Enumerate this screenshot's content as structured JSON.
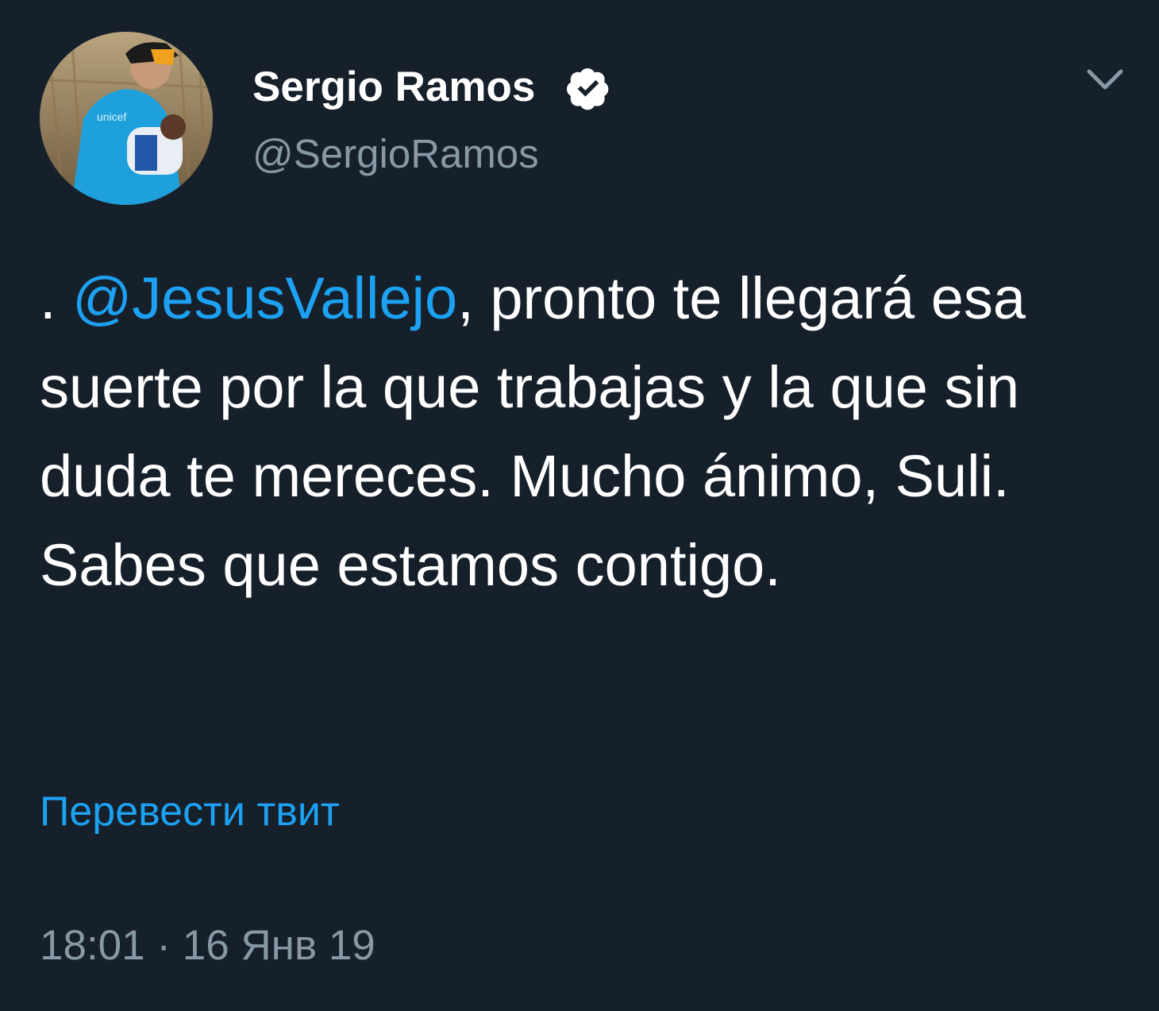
{
  "author": {
    "display_name": "Sergio Ramos",
    "verified": true,
    "handle": "@SergioRamos",
    "avatar_icon": "profile-photo"
  },
  "tweet": {
    "prefix": ". ",
    "mention": "@JesusVallejo",
    "text": ", pronto te llegará esa suerte por la que trabajas y la que sin duda te mereces. Mucho ánimo, Suli. Sabes que estamos contigo."
  },
  "translate_label": "Перевести твит",
  "timestamp": "18:01 · 16 Янв 19",
  "colors": {
    "background": "#15202b",
    "text": "#ffffff",
    "secondary": "#8899a6",
    "accent": "#1da1f2"
  },
  "icons": {
    "verified": "verified-badge-icon",
    "menu": "chevron-down-icon"
  }
}
